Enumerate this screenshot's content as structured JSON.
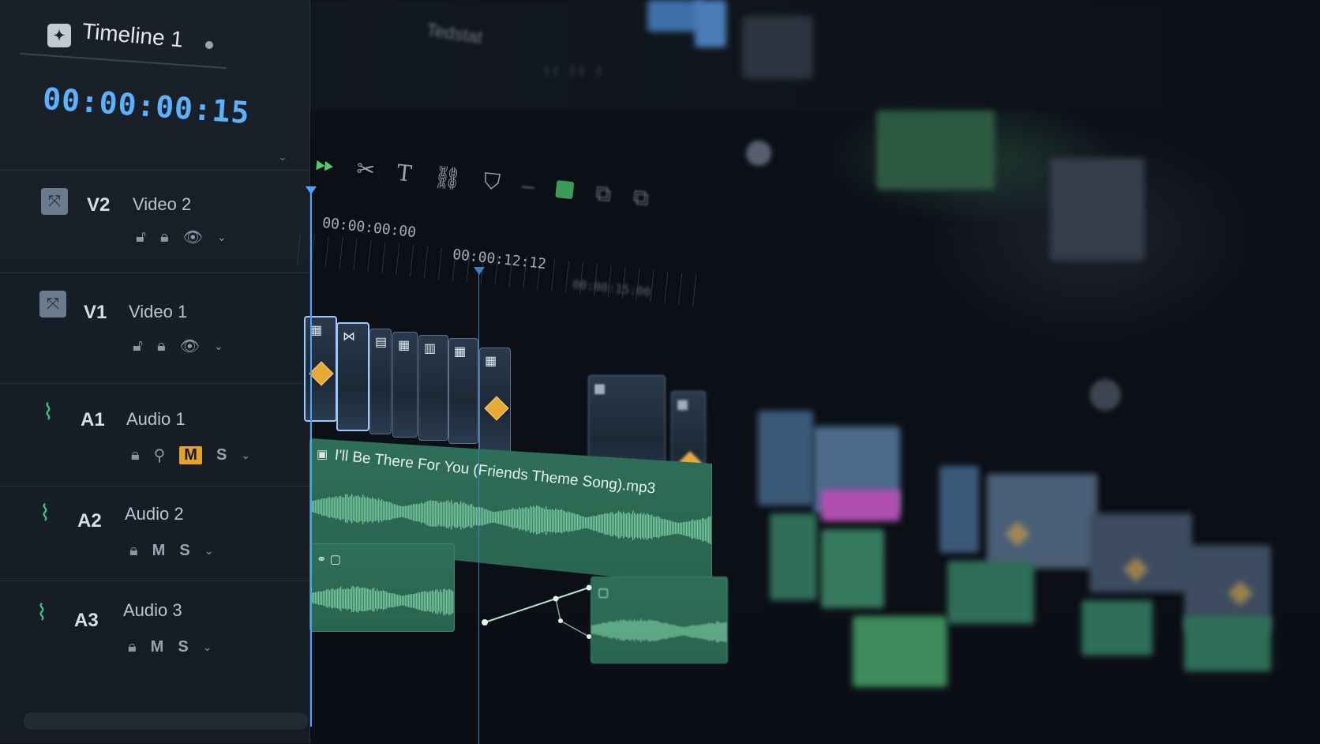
{
  "app": {
    "timeline_title": "Timeline 1",
    "timecode": "00:00:00:15"
  },
  "background": {
    "blurred_tab_label": "Tedstat",
    "blurred_tabs": "II II I"
  },
  "toolbar": {
    "play_icon": "play-icon",
    "tools": [
      "razor-icon",
      "text-icon",
      "link-icon",
      "marker-icon",
      "snap-icon",
      "ripple-icon",
      "select-icon"
    ]
  },
  "ruler": {
    "start_tc": "00:00:00:00",
    "playhead_tc": "00:00:12:12",
    "next_tc": "00:00:15:00"
  },
  "tracks": [
    {
      "code": "V2",
      "name": "Video 2",
      "type": "video"
    },
    {
      "code": "V1",
      "name": "Video 1",
      "type": "video"
    },
    {
      "code": "A1",
      "name": "Audio 1",
      "type": "audio",
      "mute_label": "M",
      "solo_label": "S",
      "muted": true
    },
    {
      "code": "A2",
      "name": "Audio 2",
      "type": "audio",
      "mute_label": "M",
      "solo_label": "S",
      "muted": false
    },
    {
      "code": "A3",
      "name": "Audio 3",
      "type": "audio",
      "mute_label": "M",
      "solo_label": "S",
      "muted": false
    }
  ],
  "clips": {
    "a1_label": "I'll Be There For You (Friends Theme Song).mp3"
  },
  "colors": {
    "timecode": "#5ab2ff",
    "playhead": "#4da3ff",
    "audio_clip": "#2f6e58",
    "keyframe": "#e8a935",
    "mute_active": "#e5a12c",
    "play_button": "#4fce6a"
  }
}
